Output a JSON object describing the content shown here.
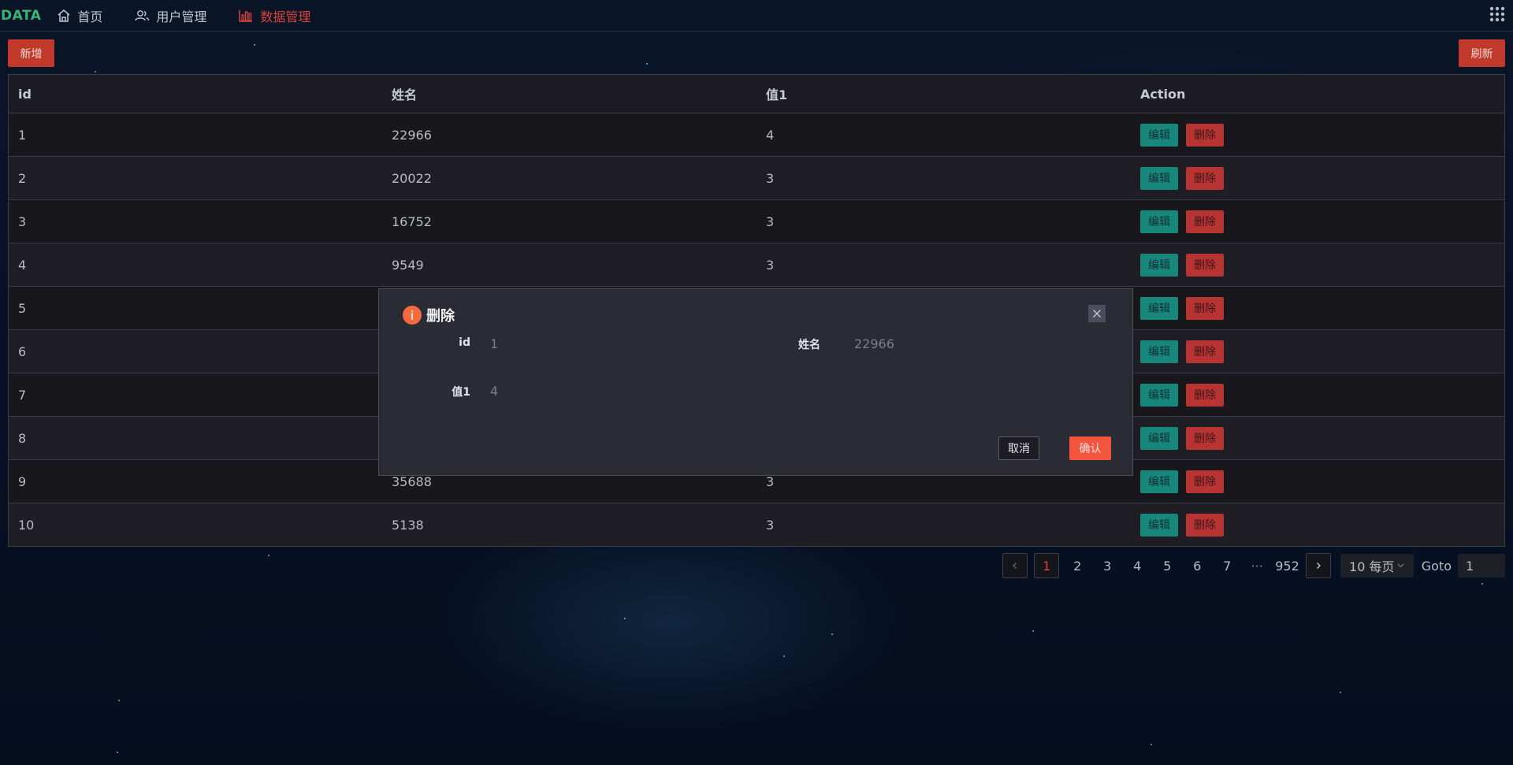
{
  "nav": {
    "logo": "DATA",
    "items": [
      {
        "label": "首页",
        "icon": "home-icon",
        "active": false
      },
      {
        "label": "用户管理",
        "icon": "users-icon",
        "active": false
      },
      {
        "label": "数据管理",
        "icon": "bar-chart-icon",
        "active": true
      }
    ],
    "apps_icon": "grid-apps-icon"
  },
  "toolbar": {
    "add_label": "新增",
    "refresh_label": "刷新"
  },
  "table": {
    "columns": [
      "id",
      "姓名",
      "值1",
      "Action"
    ],
    "rows": [
      {
        "id": "1",
        "name": "22966",
        "v1": "4"
      },
      {
        "id": "2",
        "name": "20022",
        "v1": "3"
      },
      {
        "id": "3",
        "name": "16752",
        "v1": "3"
      },
      {
        "id": "4",
        "name": "9549",
        "v1": "3"
      },
      {
        "id": "5",
        "name": "",
        "v1": ""
      },
      {
        "id": "6",
        "name": "",
        "v1": ""
      },
      {
        "id": "7",
        "name": "",
        "v1": ""
      },
      {
        "id": "8",
        "name": "",
        "v1": ""
      },
      {
        "id": "9",
        "name": "35688",
        "v1": "3"
      },
      {
        "id": "10",
        "name": "5138",
        "v1": "3"
      }
    ],
    "edit_label": "编辑",
    "delete_label": "删除"
  },
  "pagination": {
    "prev_icon": "chevron-left-icon",
    "next_icon": "chevron-right-icon",
    "current": "1",
    "pages": [
      "2",
      "3",
      "4",
      "5",
      "6",
      "7"
    ],
    "ellipsis": "···",
    "last": "952",
    "page_size": "10 每页",
    "goto_label": "Goto",
    "goto_value": "1"
  },
  "modal": {
    "title": "删除",
    "icon": "info-icon",
    "close_icon": "close-icon",
    "fields": [
      {
        "label": "id",
        "value": "1"
      },
      {
        "label": "姓名",
        "value": "22966"
      },
      {
        "label": "值1",
        "value": "4"
      }
    ],
    "cancel_label": "取消",
    "confirm_label": "确认"
  },
  "colors": {
    "accent": "#c0392b",
    "logo": "#3cb371",
    "edit": "#16877a",
    "delete": "#b83433",
    "confirm": "#f2543e"
  }
}
